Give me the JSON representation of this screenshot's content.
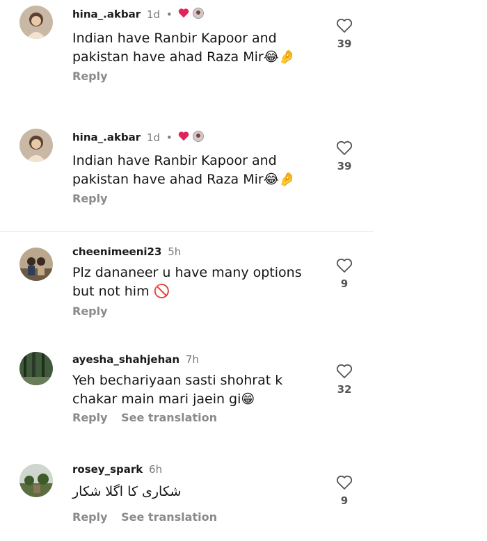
{
  "comments": [
    {
      "username": "hina_.akbar",
      "time": "1d",
      "separator": "•",
      "text": "Indian have Ranbir Kapoor and pakistan have ahad Raza Mir",
      "emoji": "😂🤌",
      "reply": "Reply",
      "likes": "39"
    },
    {
      "username": "hina_.akbar",
      "time": "1d",
      "separator": "•",
      "text": "Indian have Ranbir Kapoor and pakistan have ahad Raza Mir",
      "emoji": "😂🤌",
      "reply": "Reply",
      "likes": "39"
    },
    {
      "username": "cheenimeeni23",
      "time": "5h",
      "text": "Plz dananeer u have many options but not him",
      "emoji": "🚫",
      "reply": "Reply",
      "likes": "9"
    },
    {
      "username": "ayesha_shahjehan",
      "time": "7h",
      "text": "Yeh bechariyaan sasti shohrat k chakar main mari jaein gi",
      "emoji": "😁",
      "reply": "Reply",
      "translate": "See translation",
      "likes": "32"
    },
    {
      "username": "rosey_spark",
      "time": "6h",
      "text": "شکاری کا اگلا شکار",
      "reply": "Reply",
      "translate": "See translation",
      "likes": "9"
    }
  ],
  "colors": {
    "heart": "#e0245e",
    "muted": "#8a8a8a"
  }
}
